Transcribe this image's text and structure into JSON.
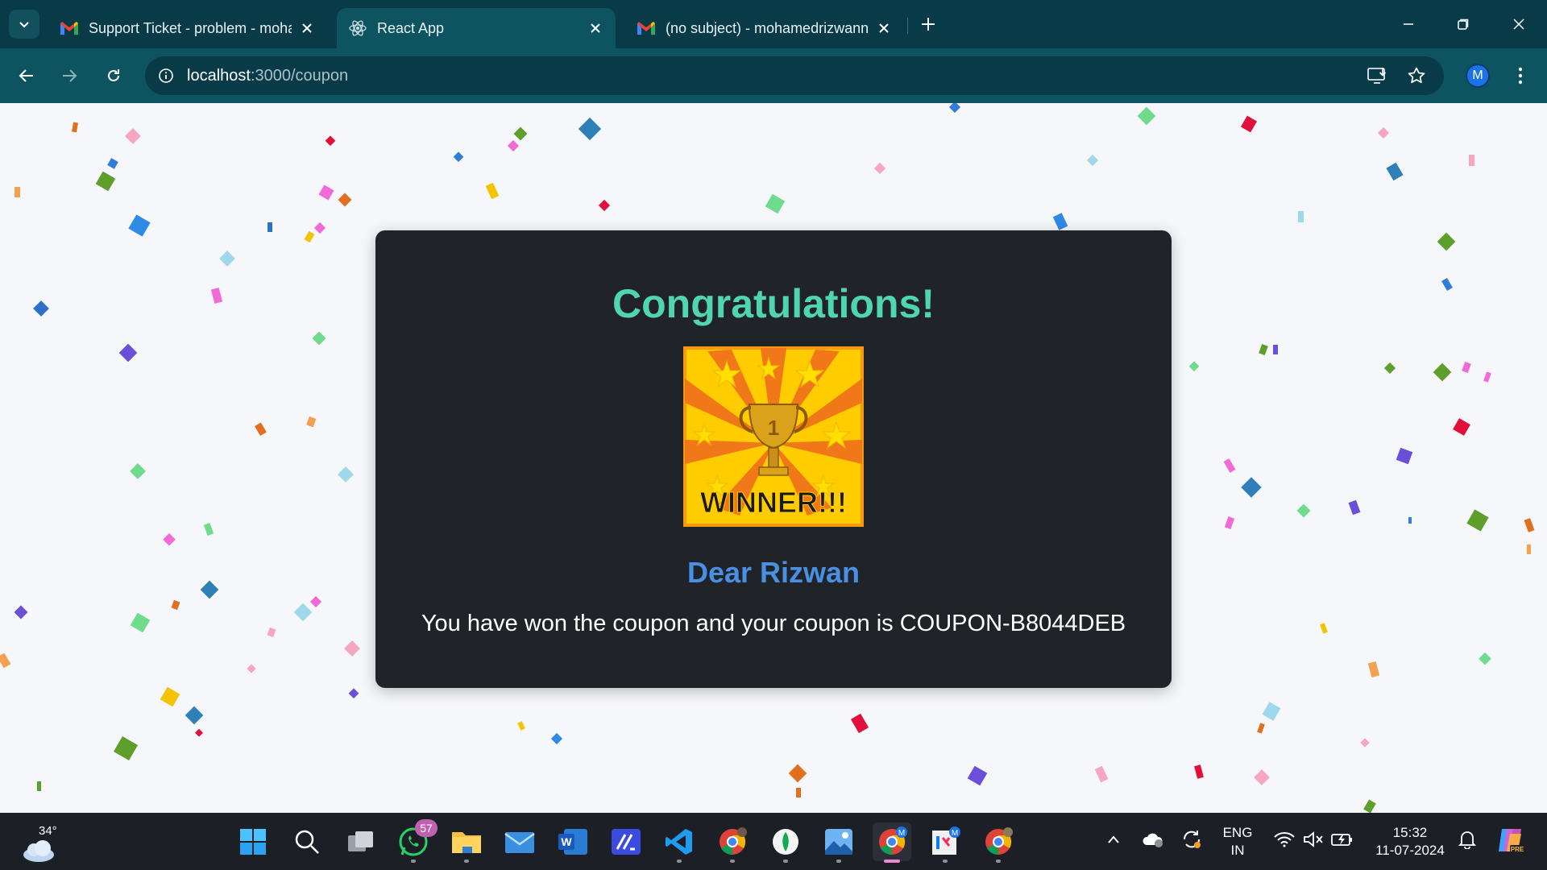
{
  "browser": {
    "tabs": [
      {
        "title": "Support Ticket - problem - mohamedrizwan",
        "icon": "gmail-icon"
      },
      {
        "title": "React App",
        "icon": "react-icon"
      },
      {
        "title": "(no subject) - mohamedrizwann",
        "icon": "gmail-icon"
      }
    ],
    "active_tab": 1,
    "url_host": "localhost",
    "url_path": ":3000/coupon",
    "profile_initial": "M"
  },
  "page": {
    "heading": "Congratulations!",
    "badge_text": "WINNER!!!",
    "badge_number": "1",
    "greeting": "Dear Rizwan",
    "message": "You have won the coupon and your coupon is COUPON-B8044DEB"
  },
  "taskbar": {
    "weather_temp": "34°",
    "whatsapp_badge": "57",
    "language_top": "ENG",
    "language_bottom": "IN",
    "time": "15:32",
    "date": "11-07-2024",
    "apps": [
      "start-icon",
      "search-icon",
      "task-view-icon",
      "whatsapp-icon",
      "file-explorer-icon",
      "mail-icon",
      "word-icon",
      "visual-studio-icon",
      "vscode-icon",
      "chrome-icon",
      "mongodb-compass-icon",
      "photos-icon",
      "chrome-icon",
      "intellij-icon",
      "chrome-icon"
    ]
  },
  "colors": {
    "chrome_dark": "#083b47",
    "chrome_toolbar": "#0d5360",
    "card_bg": "#202327",
    "heading": "#4fd6b1",
    "greeting": "#4a90e2"
  }
}
